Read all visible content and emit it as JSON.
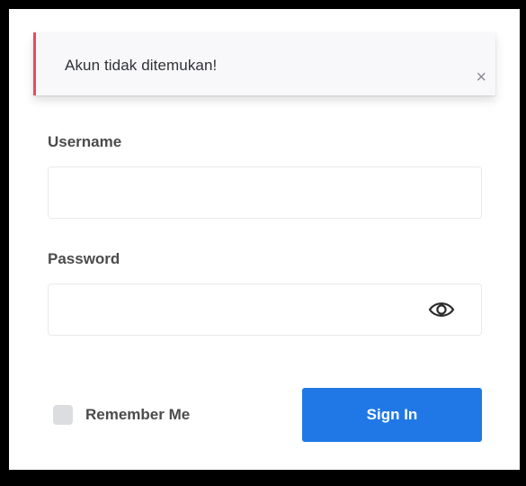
{
  "alert": {
    "message": "Akun tidak ditemukan!",
    "close_symbol": "×",
    "accent_color": "#ec4a5d",
    "close_icon": "close-icon"
  },
  "form": {
    "username": {
      "label": "Username",
      "value": "",
      "placeholder": ""
    },
    "password": {
      "label": "Password",
      "value": "",
      "placeholder": "",
      "toggle_icon": "eye-icon"
    },
    "remember": {
      "label": "Remember Me",
      "checked": false
    },
    "submit": {
      "label": "Sign In",
      "color": "#1f78e6"
    }
  }
}
